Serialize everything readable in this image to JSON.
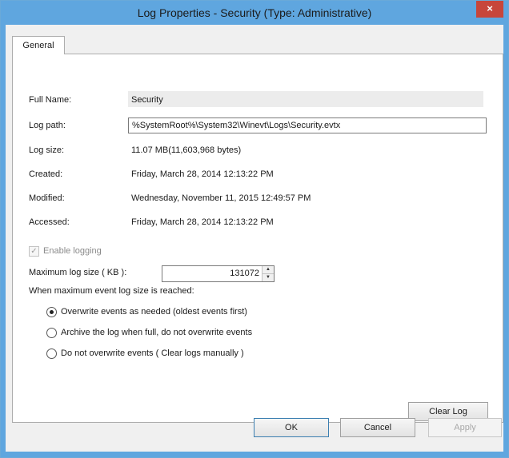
{
  "window": {
    "title": "Log Properties - Security (Type: Administrative)",
    "close_glyph": "×"
  },
  "tabs": [
    {
      "label": "General",
      "selected": true
    }
  ],
  "general": {
    "full_name_label": "Full Name:",
    "full_name_value": "Security",
    "log_path_label": "Log path:",
    "log_path_value": "%SystemRoot%\\System32\\Winevt\\Logs\\Security.evtx",
    "log_size_label": "Log size:",
    "log_size_value": "11.07 MB(11,603,968 bytes)",
    "created_label": "Created:",
    "created_value": "Friday, March 28, 2014 12:13:22 PM",
    "modified_label": "Modified:",
    "modified_value": "Wednesday, November 11, 2015 12:49:57 PM",
    "accessed_label": "Accessed:",
    "accessed_value": "Friday, March 28, 2014 12:13:22 PM",
    "enable_logging_label": "Enable logging",
    "enable_logging_checked": true,
    "max_size_label": "Maximum log size ( KB ):",
    "max_size_value": "131072",
    "when_max_label": "When maximum event log size is reached:",
    "radio_options": [
      {
        "label": "Overwrite events as needed (oldest events first)",
        "checked": true
      },
      {
        "label": "Archive the log when full, do not overwrite events",
        "checked": false
      },
      {
        "label": "Do not overwrite events ( Clear logs manually )",
        "checked": false
      }
    ],
    "clear_log_label": "Clear Log"
  },
  "footer": {
    "ok_label": "OK",
    "cancel_label": "Cancel",
    "apply_label": "Apply"
  },
  "colors": {
    "titlebar": "#5fa6df",
    "close_button": "#c7463b",
    "client_bg": "#f0f0f0"
  }
}
